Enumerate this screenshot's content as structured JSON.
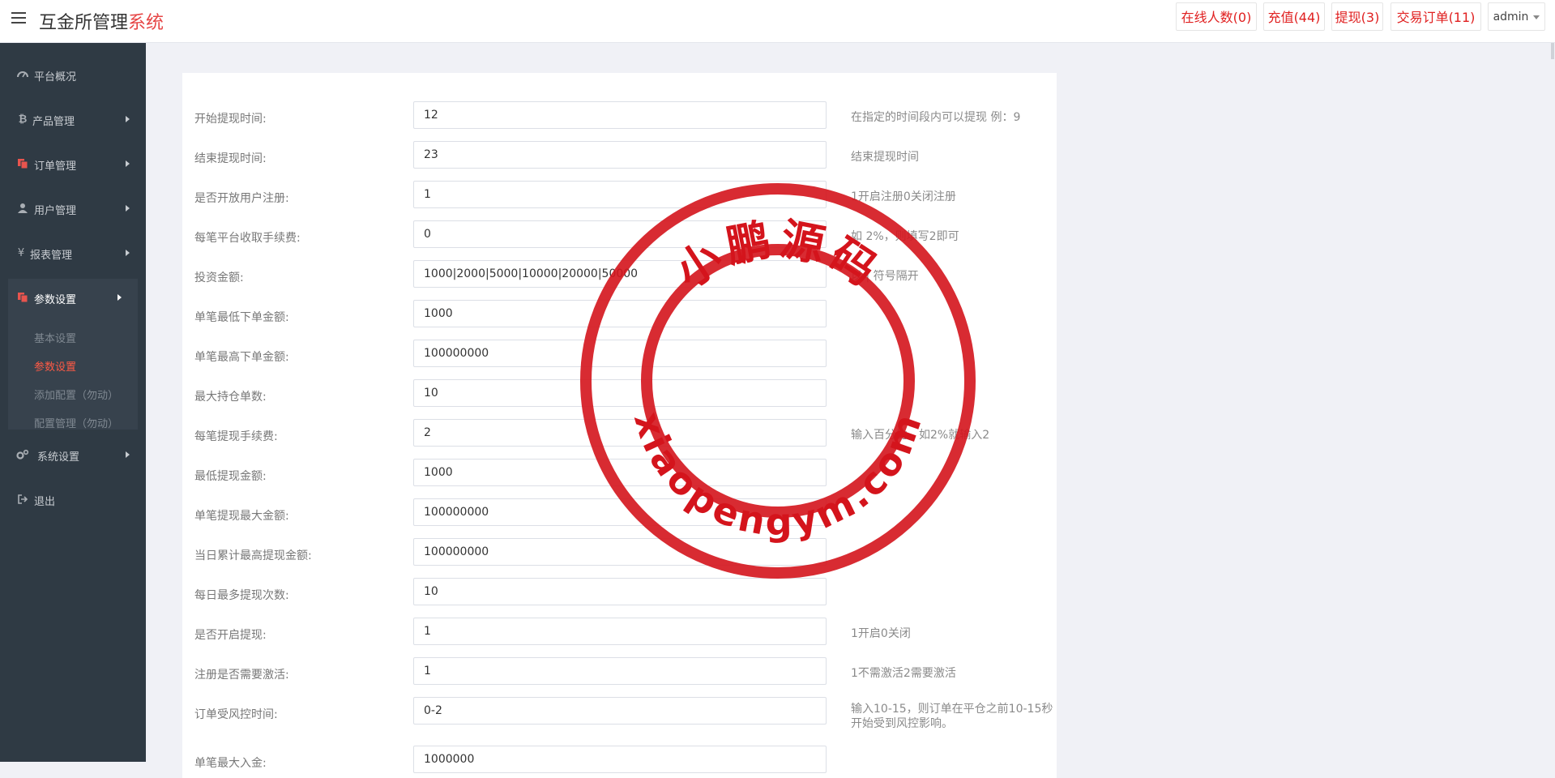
{
  "header": {
    "brand_main": "互金所管理",
    "brand_accent": "系统",
    "online_users": "在线人数(0)",
    "recharge": "充值(44)",
    "withdraw": "提现(3)",
    "trade_orders": "交易订单(11)",
    "user": "admin"
  },
  "sidebar": {
    "items": [
      {
        "label": "平台概况",
        "icon": "dashboard-icon"
      },
      {
        "label": "产品管理",
        "icon": "bitcoin-icon"
      },
      {
        "label": "订单管理",
        "icon": "copy-icon"
      },
      {
        "label": "用户管理",
        "icon": "user-icon"
      },
      {
        "label": "报表管理",
        "icon": "yen-icon"
      },
      {
        "label": "参数设置",
        "icon": "copy-icon"
      },
      {
        "label": "系统设置",
        "icon": "cogs-icon"
      },
      {
        "label": "退出",
        "icon": "sign-out-icon"
      }
    ],
    "subitems": [
      {
        "label": "基本设置"
      },
      {
        "label": "参数设置"
      },
      {
        "label": "添加配置（勿动）"
      },
      {
        "label": "配置管理（勿动）"
      }
    ]
  },
  "form": {
    "fields": [
      {
        "label": "开始提现时间:",
        "value": "12",
        "hint": "在指定的时间段内可以提现 例：9"
      },
      {
        "label": "结束提现时间:",
        "value": "23",
        "hint": "结束提现时间"
      },
      {
        "label": "是否开放用户注册:",
        "value": "1",
        "hint": "1开启注册0关闭注册"
      },
      {
        "label": "每笔平台收取手续费:",
        "value": "0",
        "hint": "如 2%，则填写2即可"
      },
      {
        "label": "投资金额:",
        "value": "1000|2000|5000|10000|20000|50000",
        "hint": "以 | 符号隔开"
      },
      {
        "label": "单笔最低下单金额:",
        "value": "1000",
        "hint": ""
      },
      {
        "label": "单笔最高下单金额:",
        "value": "100000000",
        "hint": ""
      },
      {
        "label": "最大持仓单数:",
        "value": "10",
        "hint": ""
      },
      {
        "label": "每笔提现手续费:",
        "value": "2",
        "hint": "输入百分比，如2%就输入2"
      },
      {
        "label": "最低提现金额:",
        "value": "1000",
        "hint": ""
      },
      {
        "label": "单笔提现最大金额:",
        "value": "100000000",
        "hint": ""
      },
      {
        "label": "当日累计最高提现金额:",
        "value": "100000000",
        "hint": ""
      },
      {
        "label": "每日最多提现次数:",
        "value": "10",
        "hint": ""
      },
      {
        "label": "是否开启提现:",
        "value": "1",
        "hint": "1开启0关闭"
      },
      {
        "label": "注册是否需要激活:",
        "value": "1",
        "hint": "1不需激活2需要激活"
      },
      {
        "label": "订单受风控时间:",
        "value": "0-2",
        "hint": "输入10-15，则订单在平仓之前10-15秒开始受到风控影响。"
      },
      {
        "label": "单笔最大入金:",
        "value": "1000000",
        "hint": ""
      }
    ]
  },
  "watermark": {
    "top_text": "小鹏源码",
    "bottom_text": "xiaopengym.com",
    "color": "#d4141c"
  },
  "colors": {
    "accent": "#e64545",
    "sidebar_bg": "#2f3a44",
    "badge_text": "#e02020"
  }
}
